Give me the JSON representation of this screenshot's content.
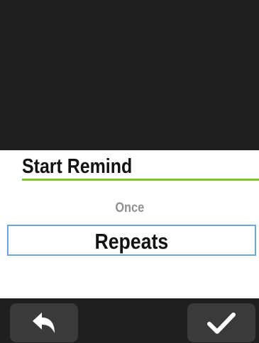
{
  "dialog": {
    "title": "Start Remind",
    "options": [
      {
        "label": "Once",
        "selected": false
      },
      {
        "label": "Repeats",
        "selected": true
      }
    ]
  },
  "footer": {
    "back_icon": "back-arrow-icon",
    "confirm_icon": "checkmark-icon"
  },
  "colors": {
    "background": "#1f1f1f",
    "sheet": "#ffffff",
    "accent_rule": "#7cc52f",
    "selection_border": "#6ba6dd",
    "button": "#3a3a3a",
    "muted_text": "#8f8f8f"
  }
}
